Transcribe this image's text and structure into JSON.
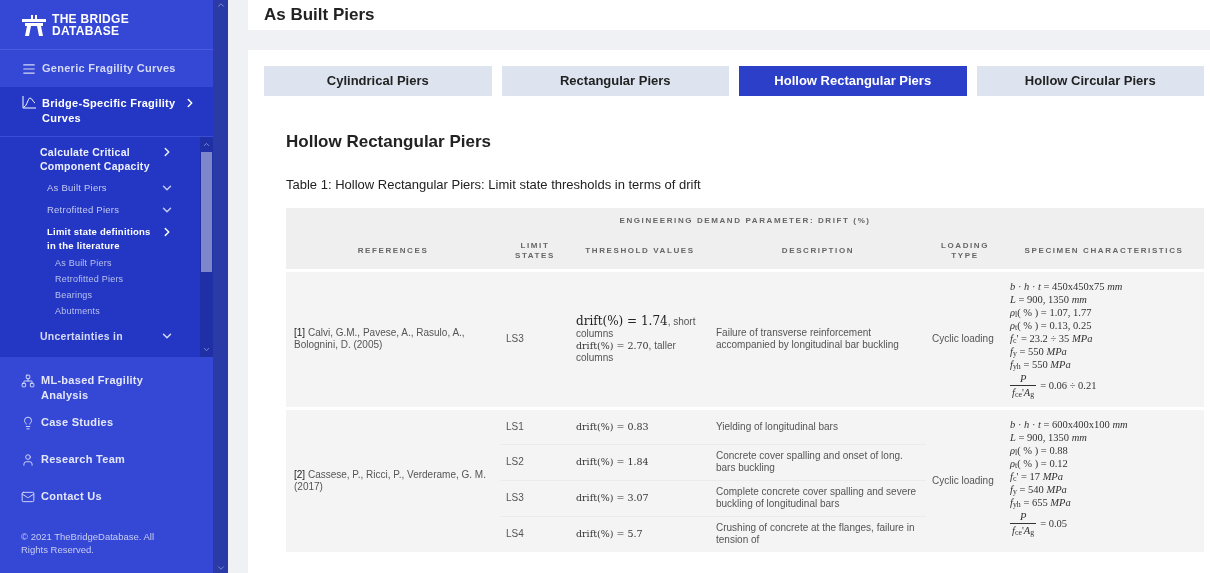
{
  "sidebar": {
    "logo": {
      "line1": "THE BRIDGE",
      "line2": "DATABASE"
    },
    "top_items": [
      {
        "label": "Generic Fragility Curves"
      }
    ],
    "section": {
      "label": "Bridge-Specific Fragility Curves",
      "expanded": true,
      "children": [
        {
          "label": "Calculate Critical Component Capacity",
          "expanded": true,
          "selected": false,
          "children": [
            {
              "label": "As Built Piers",
              "expanded": false,
              "selected": false
            },
            {
              "label": "Retrofitted Piers",
              "expanded": false,
              "selected": false
            },
            {
              "label": "Limit state definitions in the literature",
              "expanded": true,
              "selected": true,
              "children": [
                {
                  "label": "As Built Piers",
                  "selected": false
                },
                {
                  "label": "Retrofitted Piers",
                  "selected": false
                },
                {
                  "label": "Bearings",
                  "selected": false
                },
                {
                  "label": "Abutments",
                  "selected": false
                }
              ]
            }
          ]
        },
        {
          "label": "Uncertainties in",
          "expanded": false,
          "selected": false
        }
      ]
    },
    "bottom_items": [
      {
        "label": "ML-based Fragility Analysis"
      },
      {
        "label": "Case Studies"
      },
      {
        "label": "Research Team"
      },
      {
        "label": "Contact Us"
      }
    ],
    "copyright": "© 2021 TheBridgeDatabase. All Rights Reserved."
  },
  "page_title": "As Built Piers",
  "tabs": [
    {
      "label": "Cylindrical Piers",
      "selected": false
    },
    {
      "label": "Rectangular Piers",
      "selected": false
    },
    {
      "label": "Hollow Rectangular Piers",
      "selected": true
    },
    {
      "label": "Hollow Circular Piers",
      "selected": false
    }
  ],
  "heading": "Hollow Rectangular Piers",
  "caption": "Table 1: Hollow Rectangular Piers: Limit state thresholds in terms of drift",
  "table": {
    "group_header": "ENGINEERING DEMAND PARAMETER: DRIFT (%)",
    "columns": [
      "REFERENCES",
      "LIMIT STATES",
      "THRESHOLD VALUES",
      "DESCRIPTION",
      "LOADING TYPE",
      "SPECIMEN CHARACTERISTICS"
    ],
    "rows": [
      {
        "reference": {
          "number": "[1]",
          "citation": "Calvi, G.M., Pavese, A., Rasulo, A., Bolognini, D. (2005)"
        },
        "loading": "Cyclic loading",
        "specimen": [
          {
            "kind": "line",
            "text": "*b* · *h* · *t* = 450x450x75 *mm*"
          },
          {
            "kind": "line",
            "text": "*L* = 900, 1350 *mm*"
          },
          {
            "kind": "line",
            "text": "*ρ*$_{l}$( % ) = 1.07, 1.77"
          },
          {
            "kind": "line",
            "text": "*ρ*$_{t}$( % ) = 0.13, 0.25"
          },
          {
            "kind": "line",
            "text": "*f*$_{c}$' = 23.2 ÷ 35 *MPa*"
          },
          {
            "kind": "line",
            "text": "*f*$_{y}$ = 550 *MPa*"
          },
          {
            "kind": "line",
            "text": "*f*$_{yh}$ = 550 *MPa*"
          },
          {
            "kind": "fraction",
            "numerator": "*P*",
            "denominator": "*f*$_{ce}$'*A*$_{g}$",
            "rest": "= 0.06 ÷ 0.21"
          }
        ],
        "states": [
          {
            "state": "LS3",
            "thresholds": [
              {
                "kind": "display",
                "math": "drift(%) = 1.74",
                "text": ", short columns"
              },
              {
                "kind": "inline",
                "math": "drift(%) = 2.70",
                "text": ", taller columns"
              }
            ],
            "description": "Failure of transverse reinforcement accompanied by longitudinal bar buckling"
          }
        ]
      },
      {
        "reference": {
          "number": "[2]",
          "citation": "Cassese, P., Ricci, P., Verderame, G. M. (2017)"
        },
        "loading": "Cyclic loading",
        "specimen": [
          {
            "kind": "line",
            "text": "*b* · *h* · *t* = 600x400x100 *mm*"
          },
          {
            "kind": "line",
            "text": "*L* = 900, 1350 *mm*"
          },
          {
            "kind": "line",
            "text": "*ρ*$_{l}$( % ) = 0.88"
          },
          {
            "kind": "line",
            "text": "*ρ*$_{t}$( % ) = 0.12"
          },
          {
            "kind": "line",
            "text": "*f*$_{c}$' = 17 *MPa*"
          },
          {
            "kind": "line",
            "text": "*f*$_{y}$ = 540 *MPa*"
          },
          {
            "kind": "line",
            "text": "*f*$_{yh}$ = 655 *MPa*"
          },
          {
            "kind": "fraction",
            "numerator": "*P*",
            "denominator": "*f*$_{ce}$'*A*$_{g}$",
            "rest": "= 0.05"
          }
        ],
        "states": [
          {
            "state": "LS1",
            "thresholds": [
              {
                "kind": "inline",
                "math": "drift(%) = 0.83"
              }
            ],
            "description": "Yielding of longitudinal bars"
          },
          {
            "state": "LS2",
            "thresholds": [
              {
                "kind": "inline",
                "math": "drift(%) = 1.84"
              }
            ],
            "description": "Concrete cover spalling and onset of long. bars buckling"
          },
          {
            "state": "LS3",
            "thresholds": [
              {
                "kind": "inline",
                "math": "drift(%) = 3.07"
              }
            ],
            "description": "Complete concrete cover spalling and severe buckling of longitudinal bars"
          },
          {
            "state": "LS4",
            "thresholds": [
              {
                "kind": "inline",
                "math": "drift(%) = 5.7"
              }
            ],
            "description": "Crushing of concrete at the flanges, failure in tension of"
          }
        ]
      }
    ]
  }
}
